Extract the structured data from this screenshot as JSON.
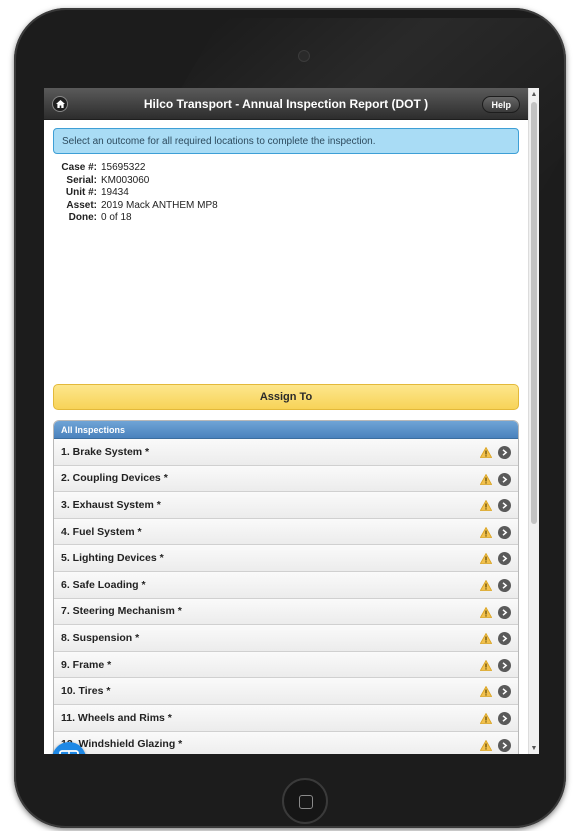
{
  "header": {
    "title": "Hilco Transport - Annual Inspection Report (DOT )",
    "help_label": "Help"
  },
  "notice": "Select an outcome for all required locations to complete the inspection.",
  "details": [
    {
      "label": "Case #:",
      "value": "15695322"
    },
    {
      "label": "Serial:",
      "value": "KM003060"
    },
    {
      "label": "Unit #:",
      "value": "19434"
    },
    {
      "label": "Asset:",
      "value": "2019 Mack ANTHEM MP8"
    },
    {
      "label": "Done:",
      "value": "0 of 18"
    }
  ],
  "assign_label": "Assign To",
  "list": {
    "header": "All Inspections",
    "items": [
      {
        "label": "1. Brake System *"
      },
      {
        "label": "2. Coupling Devices *"
      },
      {
        "label": "3. Exhaust System *"
      },
      {
        "label": "4. Fuel System *"
      },
      {
        "label": "5. Lighting Devices *"
      },
      {
        "label": "6. Safe Loading *"
      },
      {
        "label": "7. Steering Mechanism *"
      },
      {
        "label": "8. Suspension *"
      },
      {
        "label": "9. Frame *"
      },
      {
        "label": "10. Tires *"
      },
      {
        "label": "11. Wheels and Rims *"
      },
      {
        "label": "12. Windshield Glazing *"
      }
    ],
    "status_icon": "warning-icon",
    "nav_icon": "chevron-right-icon"
  },
  "colors": {
    "accent": "#4a82bd",
    "notice_bg": "#a9dcf5",
    "assign_bg": "#f7d358",
    "warning": "#f2c14e"
  }
}
